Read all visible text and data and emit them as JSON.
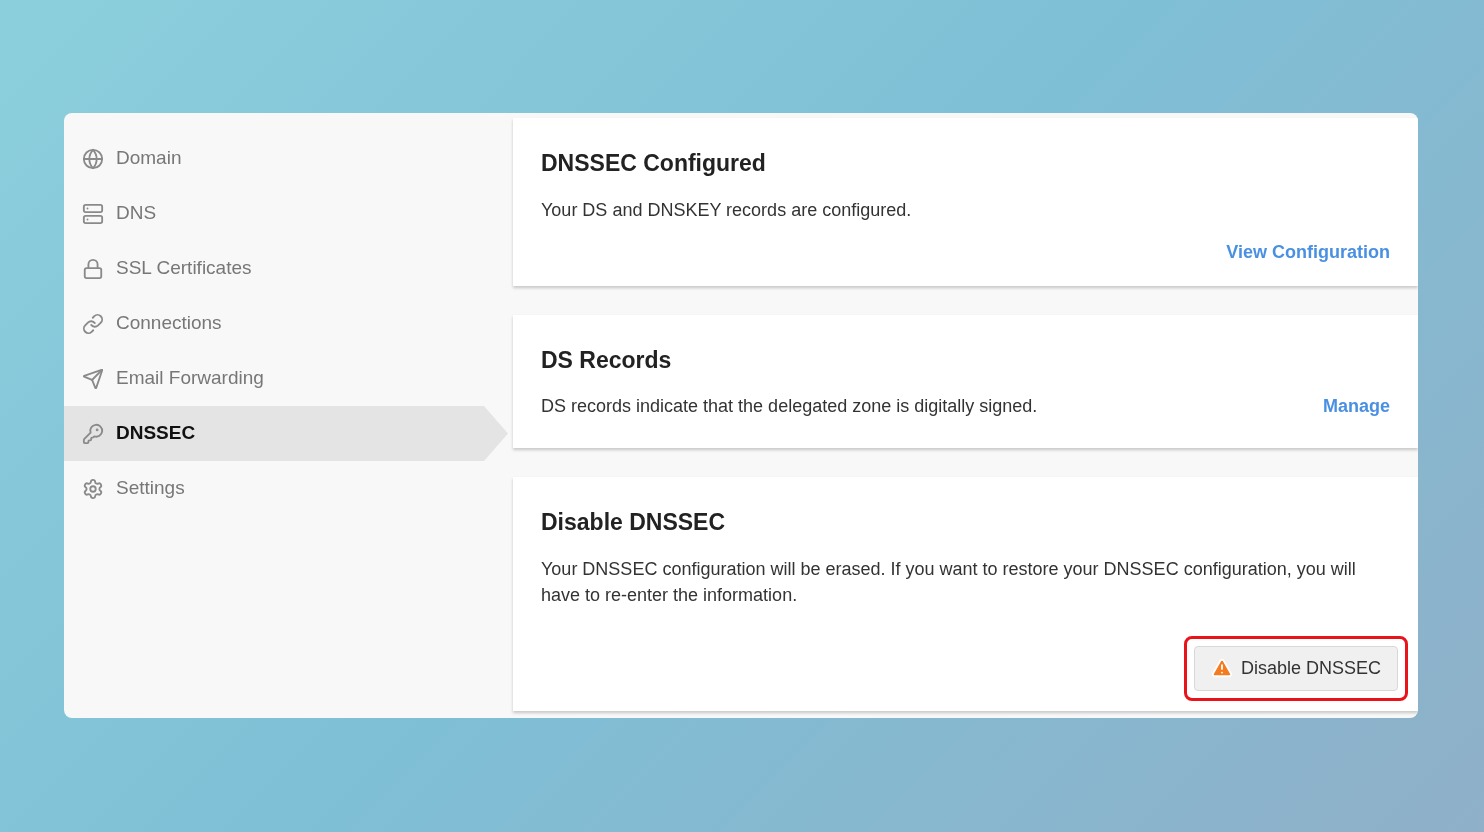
{
  "sidebar": {
    "items": [
      {
        "label": "Domain",
        "selected": false
      },
      {
        "label": "DNS",
        "selected": false
      },
      {
        "label": "SSL Certificates",
        "selected": false
      },
      {
        "label": "Connections",
        "selected": false
      },
      {
        "label": "Email Forwarding",
        "selected": false
      },
      {
        "label": "DNSSEC",
        "selected": true
      },
      {
        "label": "Settings",
        "selected": false
      }
    ]
  },
  "cards": [
    {
      "title": "DNSSEC Configured",
      "text": "Your DS and DNSKEY records are configured.",
      "action": {
        "kind": "link-below",
        "label": "View Configuration"
      }
    },
    {
      "title": "DS Records",
      "text": "DS records indicate that the delegated zone is digitally signed.",
      "action": {
        "kind": "link-inline",
        "label": "Manage"
      }
    },
    {
      "title": "Disable DNSSEC",
      "text": "Your DNSSEC configuration will be erased. If you want to restore your DNSSEC configuration, you will have to re-enter the information.",
      "action": {
        "kind": "button",
        "label": "Disable DNSSEC",
        "highlighted": true
      }
    }
  ]
}
